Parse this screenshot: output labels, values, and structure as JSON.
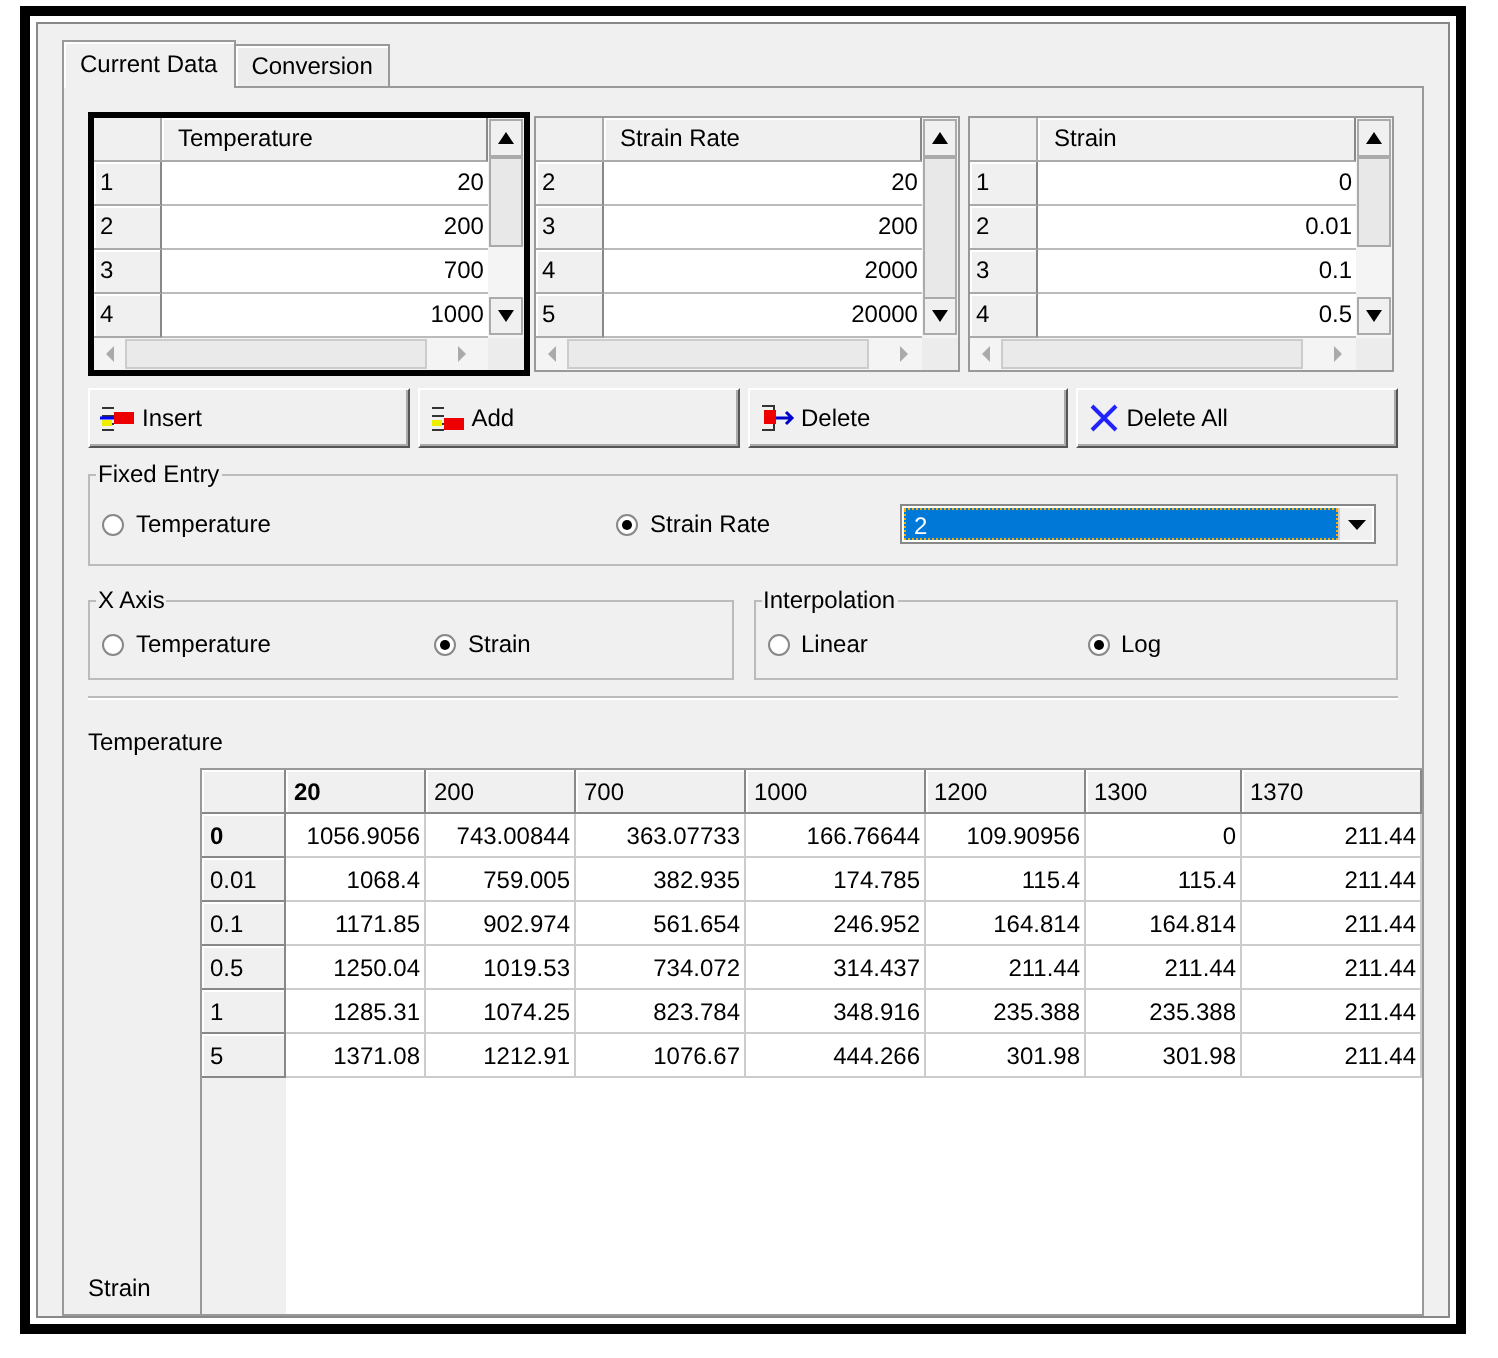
{
  "tabs": [
    {
      "label": "Current Data",
      "selected": true
    },
    {
      "label": "Conversion",
      "selected": false
    }
  ],
  "lists": [
    {
      "header": "Temperature",
      "focused": true,
      "rows": [
        {
          "index": "1",
          "value": "20"
        },
        {
          "index": "2",
          "value": "200"
        },
        {
          "index": "3",
          "value": "700"
        },
        {
          "index": "4",
          "value": "1000"
        }
      ]
    },
    {
      "header": "Strain Rate",
      "focused": false,
      "rows": [
        {
          "index": "2",
          "value": "20"
        },
        {
          "index": "3",
          "value": "200"
        },
        {
          "index": "4",
          "value": "2000"
        },
        {
          "index": "5",
          "value": "20000"
        }
      ]
    },
    {
      "header": "Strain",
      "focused": false,
      "rows": [
        {
          "index": "1",
          "value": "0"
        },
        {
          "index": "2",
          "value": "0.01"
        },
        {
          "index": "3",
          "value": "0.1"
        },
        {
          "index": "4",
          "value": "0.5"
        }
      ]
    }
  ],
  "buttons": [
    {
      "label": "Insert",
      "kind": "insert"
    },
    {
      "label": "Add",
      "kind": "add"
    },
    {
      "label": "Delete",
      "kind": "delete"
    },
    {
      "label": "Delete All",
      "kind": "clear"
    }
  ],
  "fixed_entry": {
    "title": "Fixed Entry",
    "options": [
      {
        "label": "Temperature",
        "selected": false
      },
      {
        "label": "Strain Rate",
        "selected": true
      }
    ],
    "dropdown": {
      "value": "2"
    }
  },
  "x_axis": {
    "title": "X Axis",
    "options": [
      {
        "label": "Temperature",
        "selected": false
      },
      {
        "label": "Strain",
        "selected": true
      }
    ]
  },
  "interpolation": {
    "title": "Interpolation",
    "options": [
      {
        "label": "Linear",
        "selected": false
      },
      {
        "label": "Log",
        "selected": true
      }
    ]
  },
  "table": {
    "title": "Temperature",
    "side_label": "Strain",
    "columns": [
      {
        "label": "20",
        "selected": true
      },
      {
        "label": "200",
        "selected": false
      },
      {
        "label": "700",
        "selected": false
      },
      {
        "label": "1000",
        "selected": false
      },
      {
        "label": "1200",
        "selected": false
      },
      {
        "label": "1300",
        "selected": false
      },
      {
        "label": "1370",
        "selected": false
      }
    ],
    "rows": [
      {
        "header": "0",
        "selected": true,
        "cells": [
          "1056.9056",
          "743.00844",
          "363.07733",
          "166.76644",
          "109.90956",
          "0",
          "211.44"
        ]
      },
      {
        "header": "0.01",
        "selected": false,
        "cells": [
          "1068.4",
          "759.005",
          "382.935",
          "174.785",
          "115.4",
          "115.4",
          "211.44"
        ]
      },
      {
        "header": "0.1",
        "selected": false,
        "cells": [
          "1171.85",
          "902.974",
          "561.654",
          "246.952",
          "164.814",
          "164.814",
          "211.44"
        ]
      },
      {
        "header": "0.5",
        "selected": false,
        "cells": [
          "1250.04",
          "1019.53",
          "734.072",
          "314.437",
          "211.44",
          "211.44",
          "211.44"
        ]
      },
      {
        "header": "1",
        "selected": false,
        "cells": [
          "1285.31",
          "1074.25",
          "823.784",
          "348.916",
          "235.388",
          "235.388",
          "211.44"
        ]
      },
      {
        "header": "5",
        "selected": false,
        "cells": [
          "1371.08",
          "1212.91",
          "1076.67",
          "444.266",
          "301.98",
          "301.98",
          "211.44"
        ]
      }
    ]
  }
}
